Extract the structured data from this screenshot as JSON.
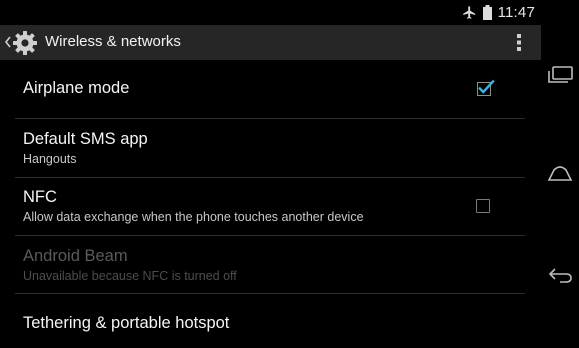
{
  "status_bar": {
    "time": "11:47",
    "icons": [
      "airplane-icon",
      "battery-icon"
    ]
  },
  "action_bar": {
    "title": "Wireless & networks",
    "icons": [
      "up-caret-icon",
      "settings-gear-icon",
      "overflow-menu-icon"
    ]
  },
  "settings": [
    {
      "title": "Airplane mode",
      "summary": "",
      "checkbox": true,
      "checked": true,
      "enabled": true
    },
    {
      "title": "Default SMS app",
      "summary": "Hangouts",
      "checkbox": false,
      "enabled": true
    },
    {
      "title": "NFC",
      "summary": "Allow data exchange when the phone touches another device",
      "checkbox": true,
      "checked": false,
      "enabled": true
    },
    {
      "title": "Android Beam",
      "summary": "Unavailable because NFC is turned off",
      "checkbox": false,
      "enabled": false
    },
    {
      "title": "Tethering & portable hotspot",
      "summary": "",
      "checkbox": false,
      "enabled": true
    }
  ],
  "colors": {
    "accent_check": "#33b5e5",
    "action_bar_bg": "#262626"
  },
  "nav_bar": {
    "icons": [
      "recent-apps-icon",
      "home-icon",
      "back-icon"
    ]
  }
}
